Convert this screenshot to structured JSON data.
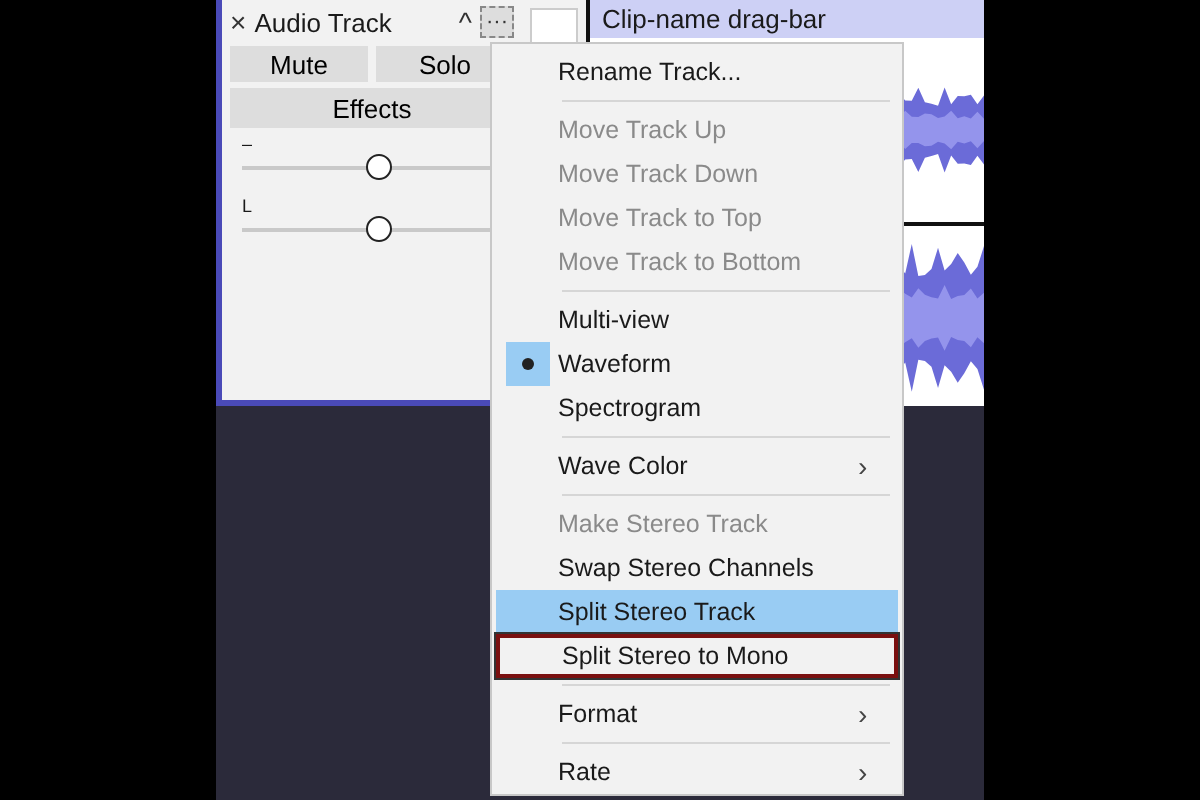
{
  "track": {
    "close": "×",
    "name": "Audio Track",
    "collapse": "^",
    "menu_button": "···",
    "buttons": [
      "Mute",
      "Solo"
    ],
    "effects": "Effects",
    "sliders": [
      {
        "label": "–",
        "level": 0.5
      },
      {
        "label": "L",
        "level": 0.5
      }
    ]
  },
  "clip": {
    "name": "Clip-name drag-bar"
  },
  "menu": [
    {
      "kind": "item",
      "label": "Rename Track...",
      "disabled": false,
      "checked": false,
      "selected": false,
      "outlined": false
    },
    {
      "kind": "separator"
    },
    {
      "kind": "item",
      "label": "Move Track Up",
      "disabled": true,
      "checked": false,
      "selected": false,
      "outlined": false
    },
    {
      "kind": "item",
      "label": "Move Track Down",
      "disabled": true,
      "checked": false,
      "selected": false,
      "outlined": false
    },
    {
      "kind": "item",
      "label": "Move Track to Top",
      "disabled": true,
      "checked": false,
      "selected": false,
      "outlined": false
    },
    {
      "kind": "item",
      "label": "Move Track to Bottom",
      "disabled": true,
      "checked": false,
      "selected": false,
      "outlined": false
    },
    {
      "kind": "separator"
    },
    {
      "kind": "item",
      "label": "Multi-view",
      "disabled": false,
      "checked": false,
      "selected": false,
      "outlined": false
    },
    {
      "kind": "item",
      "label": "Waveform",
      "disabled": false,
      "checked": true,
      "selected": false,
      "outlined": false
    },
    {
      "kind": "item",
      "label": "Spectrogram",
      "disabled": false,
      "checked": false,
      "selected": false,
      "outlined": false
    },
    {
      "kind": "separator"
    },
    {
      "kind": "item",
      "label": "Wave Color",
      "submenu": "›",
      "disabled": false,
      "checked": false,
      "selected": false,
      "outlined": false
    },
    {
      "kind": "separator"
    },
    {
      "kind": "item",
      "label": "Make Stereo Track",
      "disabled": true,
      "checked": false,
      "selected": false,
      "outlined": false
    },
    {
      "kind": "item",
      "label": "Swap Stereo Channels",
      "disabled": false,
      "checked": false,
      "selected": false,
      "outlined": false
    },
    {
      "kind": "item",
      "label": "Split Stereo Track",
      "disabled": false,
      "checked": false,
      "selected": true,
      "outlined": false
    },
    {
      "kind": "item",
      "label": "Split Stereo to Mono",
      "disabled": false,
      "checked": false,
      "selected": false,
      "outlined": true
    },
    {
      "kind": "separator"
    },
    {
      "kind": "item",
      "label": "Format",
      "submenu": "›",
      "disabled": false,
      "checked": false,
      "selected": false,
      "outlined": false
    },
    {
      "kind": "separator"
    },
    {
      "kind": "item",
      "label": "Rate",
      "submenu": "›",
      "disabled": false,
      "checked": false,
      "selected": false,
      "outlined": false
    }
  ]
}
